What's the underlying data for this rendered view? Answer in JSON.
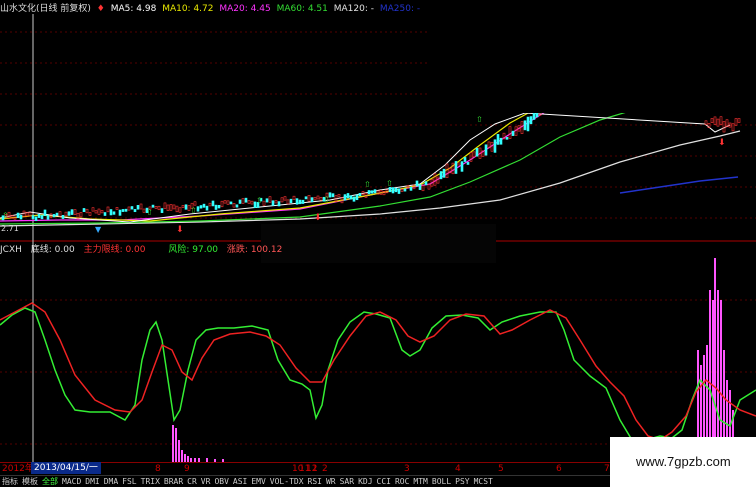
{
  "top_legend": {
    "title": "山水文化(日线 前复权)",
    "ma5": "MA5: 4.98",
    "ma10": "MA10: 4.72",
    "ma20": "MA20: 4.45",
    "ma60": "MA60: 4.51",
    "ma120": "MA120: -",
    "ma250": "MA250: -"
  },
  "price_label": "2.71",
  "indicator_legend": {
    "name": "JCXH",
    "bottom": "底线: 0.00",
    "main": "主力限线: 0.00",
    "risk": "风险: 97.00",
    "rise": "涨跌: 100.12"
  },
  "date_bar": {
    "year": "2012年",
    "selected": "2013/04/15/一",
    "marks": [
      "8",
      "9",
      "10",
      "11",
      "12",
      "1",
      "2",
      "3",
      "4",
      "5",
      "6",
      "7"
    ]
  },
  "tabs": [
    "指标",
    "模板",
    "全部",
    "MACD",
    "DMI",
    "DMA",
    "FSL",
    "TRIX",
    "BRAR",
    "CR",
    "VR",
    "OBV",
    "ASI",
    "EMV",
    "VOL-TDX",
    "RSI",
    "WR",
    "SAR",
    "KDJ",
    "CCI",
    "ROC",
    "MTM",
    "BOLL",
    "PSY",
    "MCST"
  ],
  "watermark": "www.7gpzb.com",
  "colors": {
    "ma5": "#ffffff",
    "ma10": "#e8e800",
    "ma20": "#ff33ff",
    "ma60": "#33dd33",
    "ma120": "#e0e0e0",
    "ma250": "#2233cc",
    "up": "#ff3333",
    "down": "#33ffff",
    "kline": "#33ee33",
    "dline": "#ee2222",
    "bar": "#ff55ff"
  }
}
